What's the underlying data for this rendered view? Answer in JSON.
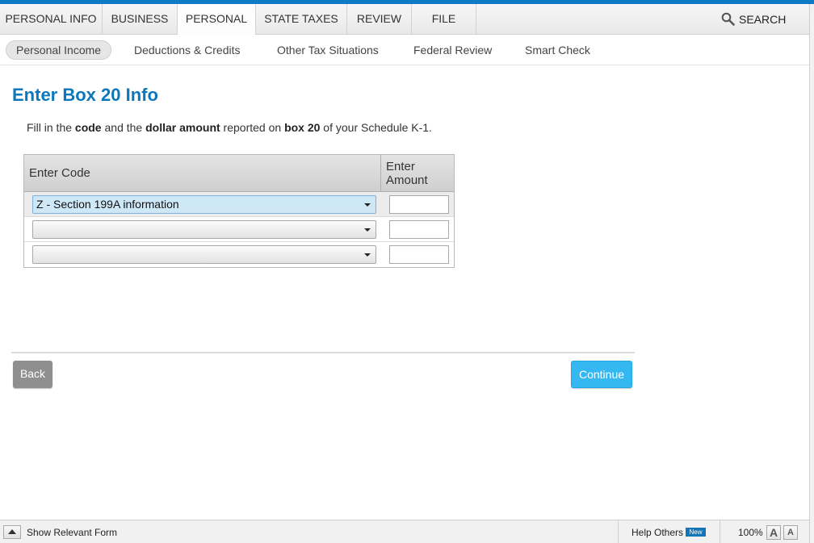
{
  "main_nav": {
    "tabs": [
      {
        "label": "PERSONAL INFO"
      },
      {
        "label": "BUSINESS"
      },
      {
        "label": "PERSONAL"
      },
      {
        "label": "STATE TAXES"
      },
      {
        "label": "REVIEW"
      },
      {
        "label": "FILE"
      }
    ],
    "active_tab": "PERSONAL",
    "search_label": "SEARCH",
    "search_icon": "magnifier-icon"
  },
  "sub_nav": {
    "items": [
      {
        "label": "Personal Income"
      },
      {
        "label": "Deductions & Credits"
      },
      {
        "label": "Other Tax Situations"
      },
      {
        "label": "Federal Review"
      },
      {
        "label": "Smart Check"
      }
    ],
    "active_item": "Personal Income"
  },
  "page": {
    "title": "Enter Box 20 Info",
    "instruction": {
      "t1": "Fill in the ",
      "b1": "code",
      "t2": " and the ",
      "b2": "dollar amount",
      "t3": " reported on ",
      "b3": "box 20",
      "t4": " of your Schedule K-1."
    }
  },
  "table": {
    "col_code": "Enter Code",
    "col_amount_line1": "Enter",
    "col_amount_line2": "Amount",
    "rows": [
      {
        "code": "Z - Section 199A information",
        "amount": ""
      },
      {
        "code": "",
        "amount": ""
      },
      {
        "code": "",
        "amount": ""
      }
    ]
  },
  "buttons": {
    "back": "Back",
    "continue": "Continue"
  },
  "status_bar": {
    "show_form": "Show Relevant Form",
    "help_others": "Help Others",
    "new_badge": "New",
    "zoom": "100%",
    "font_large": "A",
    "font_small": "A"
  },
  "colors": {
    "accent": "#0d7ac6",
    "title": "#0b78bd",
    "continue": "#35b8f2",
    "back": "#8f8f8f"
  }
}
